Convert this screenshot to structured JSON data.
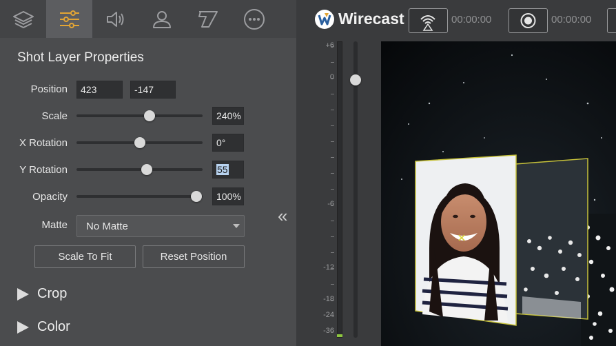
{
  "toolbar": {
    "tabs": [
      {
        "icon": "layers-icon"
      },
      {
        "icon": "sliders-icon",
        "active": true
      },
      {
        "icon": "speaker-icon"
      },
      {
        "icon": "person-icon"
      },
      {
        "icon": "title-icon"
      },
      {
        "icon": "more-icon"
      }
    ]
  },
  "panel": {
    "title": "Shot Layer Properties",
    "position": {
      "label": "Position",
      "x": "423",
      "y": "-147"
    },
    "scale": {
      "label": "Scale",
      "value": "240%",
      "level": 0.58
    },
    "x_rotation": {
      "label": "X Rotation",
      "value": "0°",
      "level": 0.5
    },
    "y_rotation": {
      "label": "Y Rotation",
      "value": "55",
      "level": 0.56
    },
    "opacity": {
      "label": "Opacity",
      "value": "100%",
      "level": 0.95
    },
    "matte": {
      "label": "Matte",
      "selected": "No Matte"
    },
    "scale_to_fit_label": "Scale To Fit",
    "reset_position_label": "Reset Position",
    "sections": {
      "crop": "Crop",
      "color": "Color"
    },
    "collapse_glyph": "«"
  },
  "header": {
    "app_name": "Wirecast",
    "stream_timer": "00:00:00",
    "record_timer": "00:00:00"
  },
  "audio_meter": {
    "labels": [
      "+6",
      "0",
      "-6",
      "-12",
      "-18",
      "-24",
      "-36"
    ],
    "fader_level_db": 0
  },
  "colors": {
    "panel_bg": "#4b4c4e",
    "selection": "#b8d3f0",
    "meter_led": "#8dc63f",
    "card_border": "#c7c23a"
  }
}
